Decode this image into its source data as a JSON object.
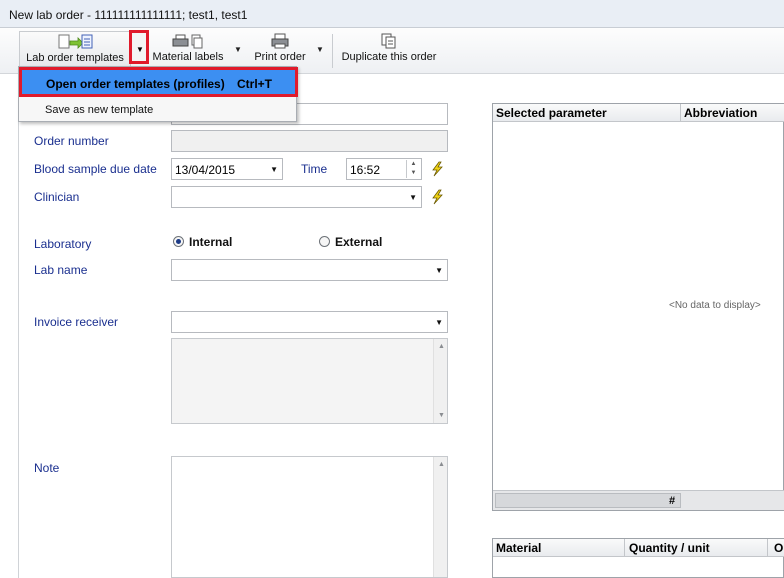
{
  "window": {
    "title": "New lab order - 111111111111111; test1, test1"
  },
  "toolbar": {
    "lab_order_templates": "Lab order templates",
    "material_labels": "Material labels",
    "print_order": "Print order",
    "duplicate_order": "Duplicate this order"
  },
  "menu": {
    "open_templates": "Open order templates (profiles)",
    "open_templates_shortcut": "Ctrl+T",
    "save_template": "Save as new template"
  },
  "form": {
    "order_number_label": "Order number",
    "blood_due_label": "Blood sample due date",
    "blood_due_value": "13/04/2015",
    "time_label": "Time",
    "time_value": "16:52",
    "clinician_label": "Clinician",
    "laboratory_label": "Laboratory",
    "internal_label": "Internal",
    "external_label": "External",
    "lab_name_label": "Lab name",
    "invoice_label": "Invoice receiver",
    "note_label": "Note"
  },
  "grid_params": {
    "col1": "Selected parameter",
    "col2": "Abbreviation",
    "empty": "<No data to display>",
    "footer": "#"
  },
  "grid_material": {
    "col1": "Material",
    "col2": "Quantity / unit",
    "col3": "Or"
  },
  "colors": {
    "accent": "#3c8ff2",
    "highlight": "#e01a2b",
    "label": "#1a2f8f"
  }
}
